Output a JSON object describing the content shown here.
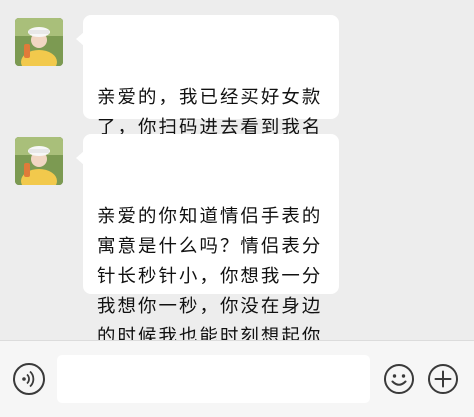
{
  "chat": {
    "messages": [
      {
        "sender": "contact",
        "text": "亲爱的，我已经买好女款\n了，你扫码进去看到我名\n字，拼买男款的就可以了"
      },
      {
        "sender": "contact",
        "text": "亲爱的你知道情侣手表的\n寓意是什么吗？情侣表分\n针长秒针小，你想我一分\n我想你一秒，你没在身边\n的时候我也能时刻想起你"
      }
    ]
  },
  "input_bar": {
    "voice_icon": "voice-icon",
    "input_value": "",
    "emoji_icon": "emoji-icon",
    "plus_icon": "plus-icon"
  },
  "colors": {
    "background": "#ededed",
    "bubble": "#ffffff",
    "input_bar": "#f6f6f6"
  }
}
